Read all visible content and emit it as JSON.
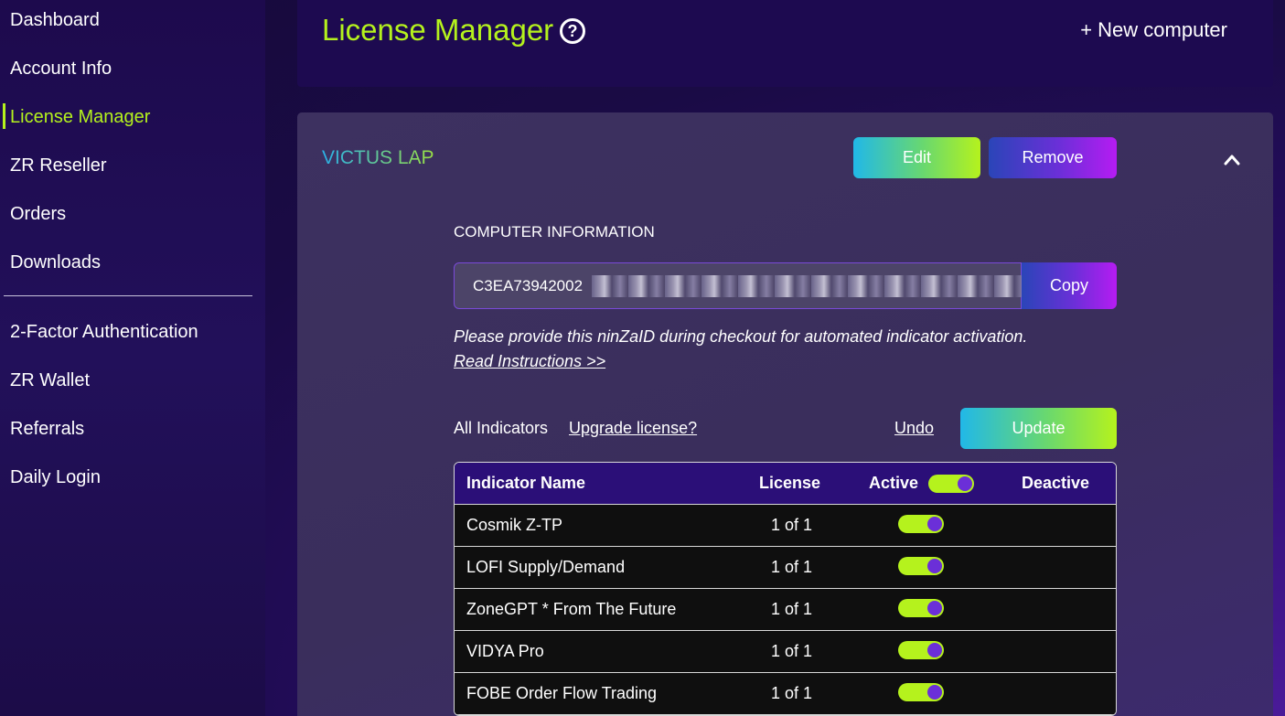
{
  "sidebar": {
    "items": [
      {
        "label": "Dashboard"
      },
      {
        "label": "Account Info"
      },
      {
        "label": "License Manager"
      },
      {
        "label": "ZR Reseller"
      },
      {
        "label": "Orders"
      },
      {
        "label": "Downloads"
      },
      {
        "label": "2-Factor Authentication"
      },
      {
        "label": "ZR Wallet"
      },
      {
        "label": "Referrals"
      },
      {
        "label": "Daily Login"
      }
    ],
    "active": "License Manager"
  },
  "header": {
    "title": "License Manager",
    "help_icon": "question-circle-icon",
    "new_computer_label": "+ New computer"
  },
  "computer": {
    "name": "VICTUS LAP",
    "edit_label": "Edit",
    "remove_label": "Remove",
    "collapse_icon": "chevron-up-icon",
    "section_label": "COMPUTER INFORMATION",
    "id_value": "C3EA73942002",
    "copy_label": "Copy",
    "note": "Please provide this ninZaID during checkout for automated indicator activation.",
    "read_instructions": "Read Instructions >>"
  },
  "indicators": {
    "filter_label": "All Indicators",
    "upgrade_label": "Upgrade license?",
    "undo_label": "Undo",
    "update_label": "Update",
    "columns": {
      "name": "Indicator Name",
      "license": "License",
      "active": "Active",
      "deactive": "Deactive"
    },
    "rows": [
      {
        "name": "Cosmik Z-TP",
        "license": "1 of 1",
        "active": true
      },
      {
        "name": "LOFI Supply/Demand",
        "license": "1 of 1",
        "active": true
      },
      {
        "name": "ZoneGPT * From The Future",
        "license": "1 of 1",
        "active": true
      },
      {
        "name": "VIDYA Pro",
        "license": "1 of 1",
        "active": true
      },
      {
        "name": "FOBE Order Flow Trading",
        "license": "1 of 1",
        "active": true
      }
    ]
  },
  "colors": {
    "accent_green": "#b5f21d",
    "accent_purple": "#6b2fd8",
    "header_purple": "#2b0f78"
  }
}
